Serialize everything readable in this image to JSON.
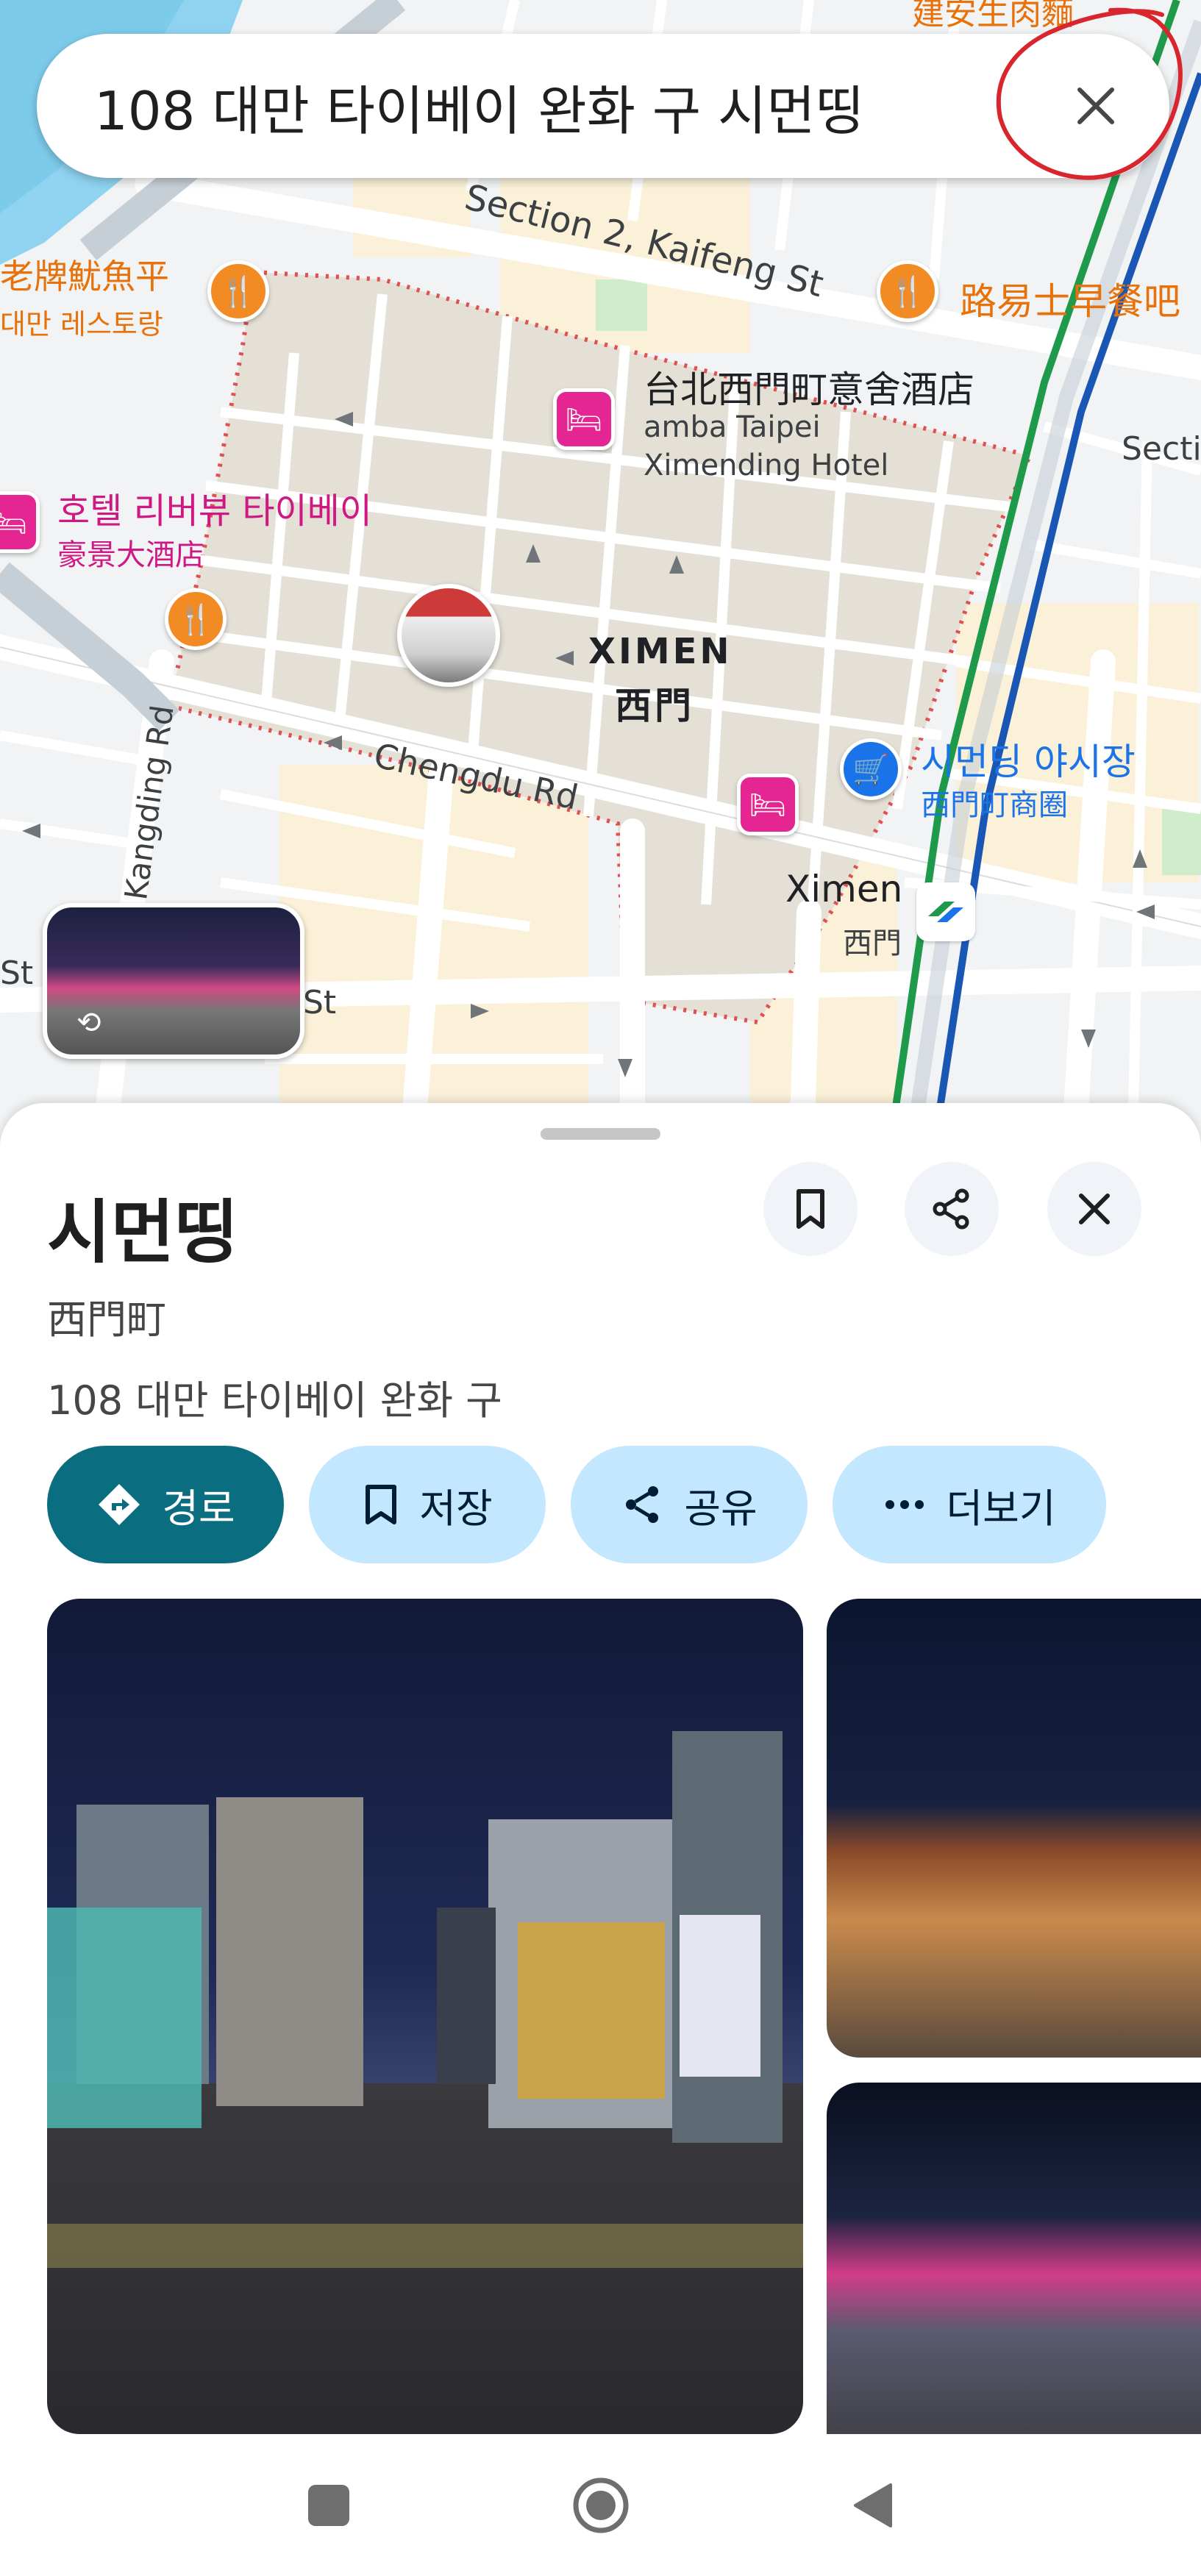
{
  "search": {
    "query": "108 대만 타이베이 완화 구 시먼띵"
  },
  "map": {
    "streets": {
      "kaifeng": "Section 2, Kaifeng St",
      "chengdu": "Chengdu Rd",
      "kangding": "Kangding Rd",
      "sect_edge": "Secti",
      "st_left": "St",
      "st_small": "St"
    },
    "restaurants": [
      {
        "name": "老牌魷魚平",
        "sub": "대만 레스토랑"
      },
      {
        "name": "路易士早餐吧"
      },
      {
        "name": "建安生肉麵"
      }
    ],
    "hotels": [
      {
        "name": "台北西門町意舍酒店",
        "sub1": "amba Taipei",
        "sub2": "Ximending Hotel"
      },
      {
        "name": "호텔 리버뷰 타이베이",
        "sub": "豪景大酒店"
      }
    ],
    "area": {
      "name": "XIMEN",
      "sub": "西門"
    },
    "market": {
      "name": "시먼딩 야시장",
      "sub": "西門町商圈"
    },
    "station": {
      "name": "Ximen",
      "sub": "西門"
    },
    "pins": {
      "restaurant_icon": "restaurant-icon",
      "hotel_icon": "hotel-icon",
      "shopping_icon": "shopping-cart-icon",
      "metro_icon": "metro-icon"
    },
    "colors": {
      "water": "#8fd3f0",
      "area_fill": "#e4e0d6",
      "road": "#ffffff",
      "minor_road": "#ffffff",
      "block": "#f1f3f4",
      "green_line": "#1e9a4a",
      "blue_line": "#1a57b5",
      "boundary": "#e05050"
    }
  },
  "place": {
    "title": "시먼띵",
    "subtitle": "西門町",
    "address": "108 대만 타이베이 완화 구"
  },
  "actions": [
    {
      "label": "경로",
      "icon": "directions-icon"
    },
    {
      "label": "저장",
      "icon": "bookmark-icon"
    },
    {
      "label": "공유",
      "icon": "share-icon"
    },
    {
      "label": "더보기",
      "icon": "more-icon"
    }
  ],
  "colors": {
    "primary_chip": "#0b6e80",
    "secondary_chip": "#c2e7ff",
    "annotation": "#d9262e"
  }
}
